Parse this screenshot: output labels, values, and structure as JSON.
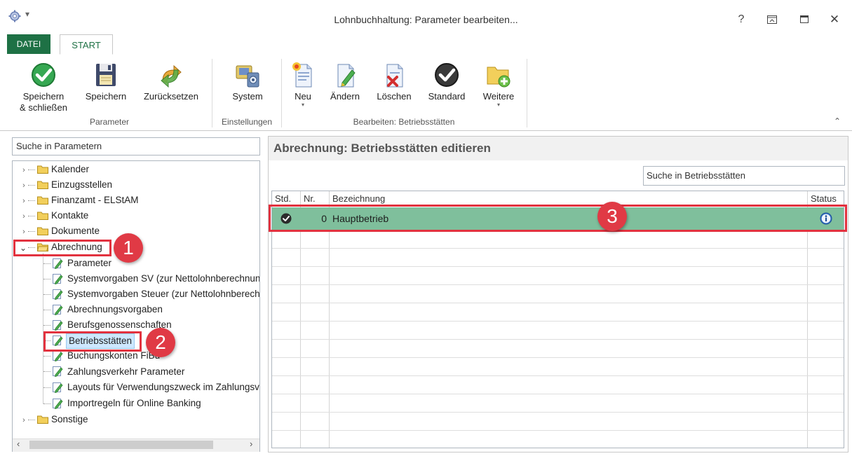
{
  "window": {
    "title": "Lohnbuchhaltung: Parameter bearbeiten...",
    "help_label": "?",
    "close_label": "✕"
  },
  "tabs": {
    "datei": "DATEI",
    "start": "START"
  },
  "ribbon": {
    "save_close_line1": "Speichern",
    "save_close_line2": "& schließen",
    "save": "Speichern",
    "reset": "Zurücksetzen",
    "group_parameter": "Parameter",
    "system": "System",
    "group_einstellungen": "Einstellungen",
    "neu": "Neu",
    "aendern": "Ändern",
    "loeschen": "Löschen",
    "standard": "Standard",
    "weitere": "Weitere",
    "group_bearbeiten": "Bearbeiten: Betriebsstätten"
  },
  "left": {
    "search_placeholder": "Suche in Parametern",
    "tree_top": [
      "Kalender",
      "Einzugsstellen",
      "Finanzamt - ELStAM",
      "Kontakte",
      "Dokumente"
    ],
    "abrechnung": "Abrechnung",
    "children": [
      "Parameter",
      "Systemvorgaben SV (zur Nettolohnberechnung)",
      "Systemvorgaben Steuer (zur Nettolohnberechnung)",
      "Abrechnungsvorgaben",
      "Berufsgenossenschaften",
      "Betriebsstätten",
      "Buchungskonten FiBu",
      "Zahlungsverkehr Parameter",
      "Layouts für Verwendungszweck im Zahlungsverkehr",
      "Importregeln für Online Banking"
    ],
    "sonstige": "Sonstige"
  },
  "right": {
    "title": "Abrechnung: Betriebsstätten editieren",
    "search_placeholder": "Suche in Betriebsstätten",
    "columns": {
      "std": "Std.",
      "nr": "Nr.",
      "bezeichnung": "Bezeichnung",
      "status": "Status"
    },
    "rows": [
      {
        "nr": "0",
        "bezeichnung": "Hauptbetrieb"
      }
    ]
  },
  "callouts": [
    "1",
    "2",
    "3"
  ],
  "colors": {
    "accent": "#1e7145",
    "selected_row": "#7fbf9c",
    "callout": "#e2323f"
  }
}
